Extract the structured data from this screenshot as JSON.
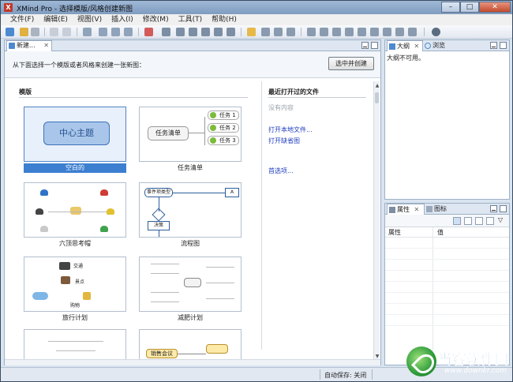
{
  "window": {
    "title": "XMind Pro - 选择模版/风格创建新图",
    "app_icon": "X"
  },
  "window_buttons": {
    "minimize": "–",
    "maximize": "□",
    "close": "✕"
  },
  "menu": [
    "文件(F)",
    "编辑(E)",
    "视图(V)",
    "插入(I)",
    "修改(M)",
    "工具(T)",
    "帮助(H)"
  ],
  "editor_tab": {
    "label": "新建...",
    "close": "✕"
  },
  "header": {
    "prompt": "从下面选择一个模版或者风格来创建一张新图：",
    "create_button": "选中并创建"
  },
  "templates_section": {
    "label": "模版",
    "items": [
      {
        "name": "空白的",
        "central": "中心主题",
        "selected": true
      },
      {
        "name": "任务清单",
        "central": "任务清单",
        "branches": [
          "任务 1",
          "任务 2",
          "任务 3"
        ]
      },
      {
        "name": "六顶思考帽"
      },
      {
        "name": "流程图",
        "nodes": [
          "事件项类型",
          "决策",
          "A"
        ]
      },
      {
        "name": "旅行计划",
        "labels": [
          "交通",
          "景点",
          "购物"
        ]
      },
      {
        "name": "减肥计划"
      },
      {
        "name": "",
        "label_text": "项目计划"
      },
      {
        "name": "",
        "label_text": "销售会议"
      }
    ]
  },
  "recent_section": {
    "title": "最近打开过的文件",
    "empty": "没有内容",
    "links": [
      "打开本地文件...",
      "打开缺省图",
      "首选项..."
    ]
  },
  "outline_pane": {
    "tabs": [
      {
        "label": "大纲",
        "icon": "outline-icon"
      },
      {
        "label": "浏览",
        "icon": "magnifier-icon"
      }
    ],
    "message": "大纲不可用。"
  },
  "properties_pane": {
    "tabs": [
      {
        "label": "属性",
        "icon": "properties-icon"
      },
      {
        "label": "图标",
        "icon": "icons-icon"
      }
    ],
    "columns": [
      "属性",
      "值"
    ]
  },
  "status": {
    "autosave": "自动保存: 关闭"
  },
  "watermark": {
    "title": "当客软件园",
    "url": "www.downkr.com"
  },
  "colors": {
    "accent": "#3c7fd0",
    "central_fill": "#a9c6ea",
    "link": "#1f3dbf"
  }
}
